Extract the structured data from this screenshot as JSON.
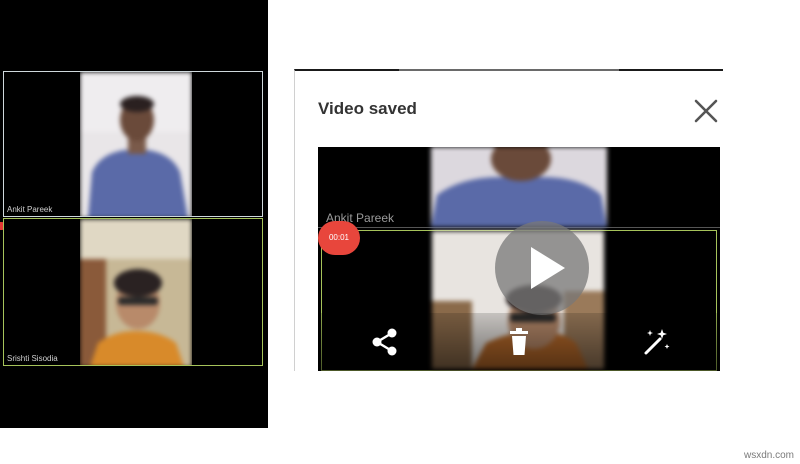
{
  "left_call": {
    "participants": [
      {
        "name": "Ankit Pareek"
      },
      {
        "name": "Srishti Sisodia"
      }
    ]
  },
  "dialog": {
    "title": "Video saved",
    "close_icon": "close-icon",
    "preview": {
      "participant_name": "Ankit Pareek",
      "recording_time": "00:01",
      "play_icon": "play-icon"
    },
    "actions": [
      {
        "icon": "share-icon"
      },
      {
        "icon": "trash-icon"
      },
      {
        "icon": "magic-wand-icon"
      }
    ]
  },
  "colors": {
    "record_red": "#e8463c",
    "active_speaker_border": "#a6c35a"
  },
  "watermark": "wsxdn.com"
}
